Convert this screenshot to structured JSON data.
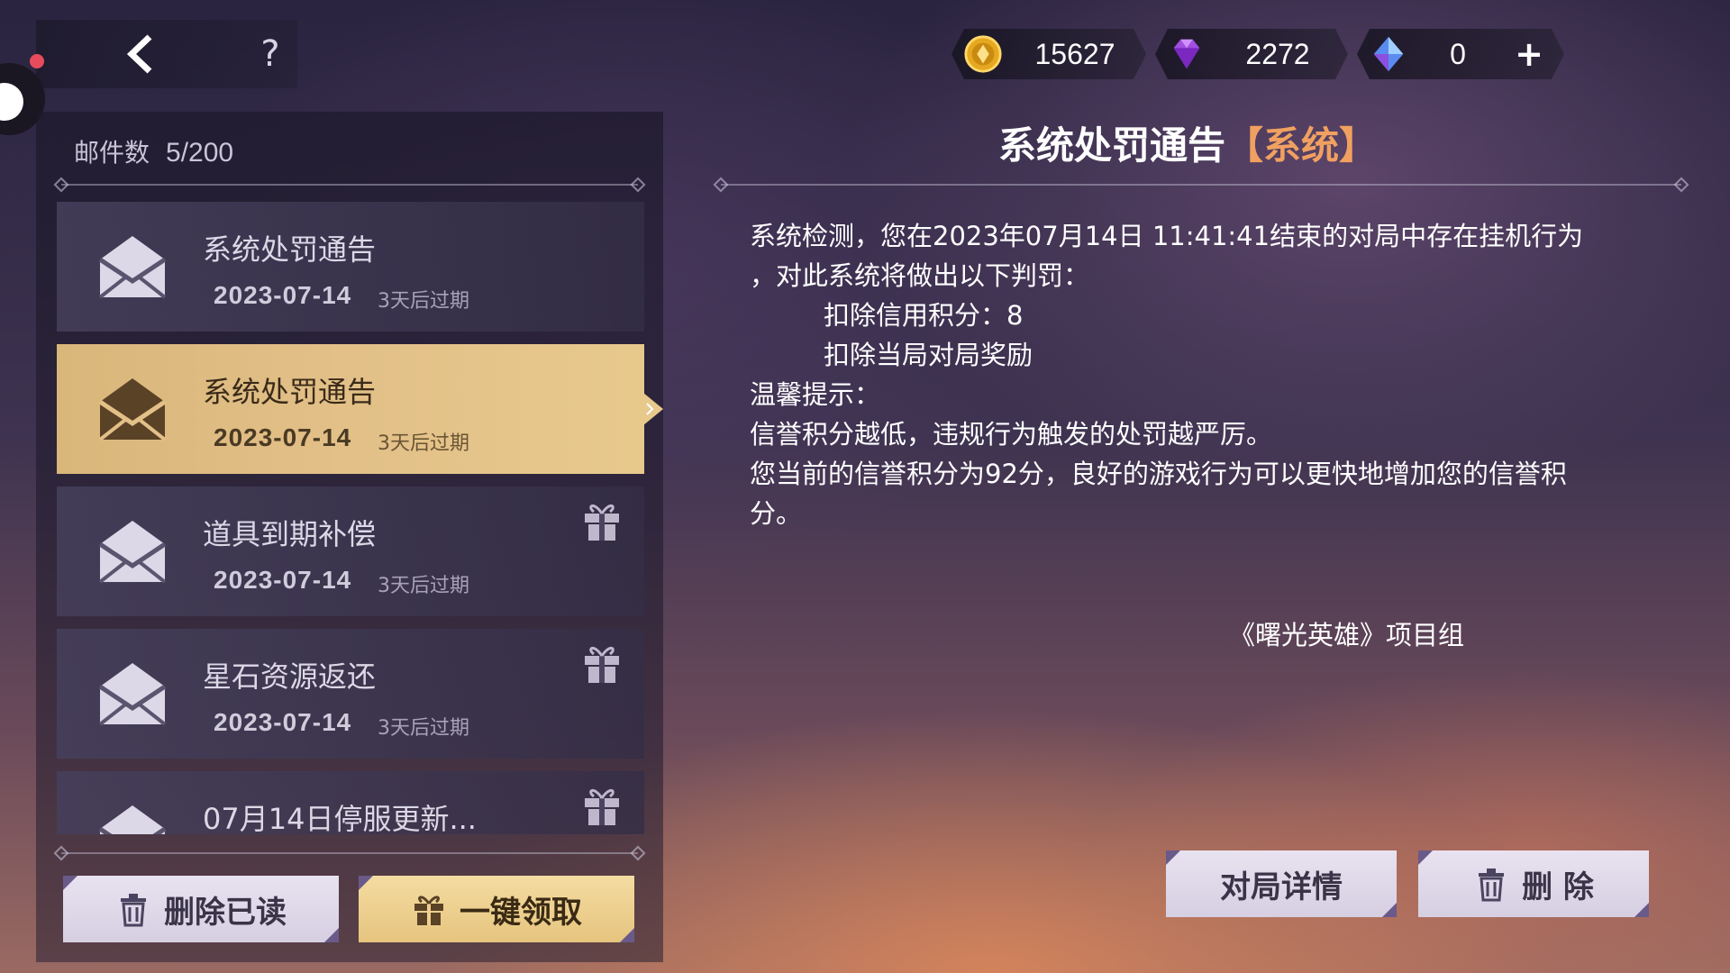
{
  "currency": {
    "coins": "15627",
    "gems": "2272",
    "crystals": "0",
    "plus": "+"
  },
  "help_label": "?",
  "mailbox": {
    "count_label": "邮件数",
    "count_value": "5/200",
    "items": [
      {
        "title": "系统处罚通告",
        "date": "2023-07-14",
        "expire": "3天后过期",
        "has_gift": false,
        "selected": false
      },
      {
        "title": "系统处罚通告",
        "date": "2023-07-14",
        "expire": "3天后过期",
        "has_gift": false,
        "selected": true
      },
      {
        "title": "道具到期补偿",
        "date": "2023-07-14",
        "expire": "3天后过期",
        "has_gift": true,
        "selected": false
      },
      {
        "title": "星石资源返还",
        "date": "2023-07-14",
        "expire": "3天后过期",
        "has_gift": true,
        "selected": false
      },
      {
        "title": "07月14日停服更新...",
        "date": "",
        "expire": "",
        "has_gift": true,
        "selected": false
      }
    ],
    "delete_read_label": "删除已读",
    "claim_all_label": "一键领取"
  },
  "detail": {
    "title": "系统处罚通告",
    "tag": "【系统】",
    "lines": [
      "系统检测，您在2023年07月14日 11:41:41结束的对局中存在挂机行为",
      "，对此系统将做出以下判罚：",
      "扣除信用积分：8",
      "扣除当局对局奖励",
      "温馨提示：",
      "信誉积分越低，违规行为触发的处罚越严厉。",
      "您当前的信誉积分为92分，良好的游戏行为可以更快地增加您的信誉积",
      "分。"
    ],
    "signature": "《曙光英雄》项目组",
    "match_details_label": "对局详情",
    "delete_label": "删 除"
  },
  "colors": {
    "selected_gold": "#e2c088",
    "tag_orange": "#f0a060",
    "button_light": "#e8e2f0"
  },
  "icons": [
    "back-arrow-icon",
    "help-icon",
    "coin-icon",
    "gem-icon",
    "crystal-icon",
    "plus-icon",
    "envelope-icon",
    "gift-icon",
    "trash-icon"
  ]
}
